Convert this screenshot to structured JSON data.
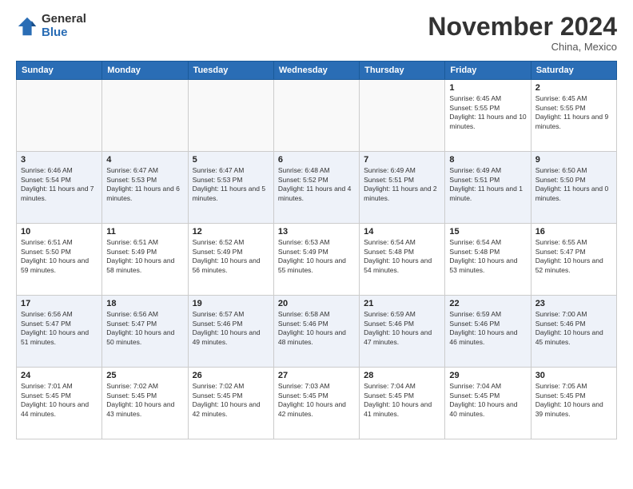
{
  "header": {
    "logo_general": "General",
    "logo_blue": "Blue",
    "month_title": "November 2024",
    "location": "China, Mexico"
  },
  "weekdays": [
    "Sunday",
    "Monday",
    "Tuesday",
    "Wednesday",
    "Thursday",
    "Friday",
    "Saturday"
  ],
  "weeks": [
    [
      {
        "day": "",
        "empty": true
      },
      {
        "day": "",
        "empty": true
      },
      {
        "day": "",
        "empty": true
      },
      {
        "day": "",
        "empty": true
      },
      {
        "day": "",
        "empty": true
      },
      {
        "day": "1",
        "sunrise": "6:45 AM",
        "sunset": "5:55 PM",
        "daylight": "11 hours and 10 minutes."
      },
      {
        "day": "2",
        "sunrise": "6:45 AM",
        "sunset": "5:55 PM",
        "daylight": "11 hours and 9 minutes."
      }
    ],
    [
      {
        "day": "3",
        "sunrise": "6:46 AM",
        "sunset": "5:54 PM",
        "daylight": "11 hours and 7 minutes."
      },
      {
        "day": "4",
        "sunrise": "6:47 AM",
        "sunset": "5:53 PM",
        "daylight": "11 hours and 6 minutes."
      },
      {
        "day": "5",
        "sunrise": "6:47 AM",
        "sunset": "5:53 PM",
        "daylight": "11 hours and 5 minutes."
      },
      {
        "day": "6",
        "sunrise": "6:48 AM",
        "sunset": "5:52 PM",
        "daylight": "11 hours and 4 minutes."
      },
      {
        "day": "7",
        "sunrise": "6:49 AM",
        "sunset": "5:51 PM",
        "daylight": "11 hours and 2 minutes."
      },
      {
        "day": "8",
        "sunrise": "6:49 AM",
        "sunset": "5:51 PM",
        "daylight": "11 hours and 1 minute."
      },
      {
        "day": "9",
        "sunrise": "6:50 AM",
        "sunset": "5:50 PM",
        "daylight": "11 hours and 0 minutes."
      }
    ],
    [
      {
        "day": "10",
        "sunrise": "6:51 AM",
        "sunset": "5:50 PM",
        "daylight": "10 hours and 59 minutes."
      },
      {
        "day": "11",
        "sunrise": "6:51 AM",
        "sunset": "5:49 PM",
        "daylight": "10 hours and 58 minutes."
      },
      {
        "day": "12",
        "sunrise": "6:52 AM",
        "sunset": "5:49 PM",
        "daylight": "10 hours and 56 minutes."
      },
      {
        "day": "13",
        "sunrise": "6:53 AM",
        "sunset": "5:49 PM",
        "daylight": "10 hours and 55 minutes."
      },
      {
        "day": "14",
        "sunrise": "6:54 AM",
        "sunset": "5:48 PM",
        "daylight": "10 hours and 54 minutes."
      },
      {
        "day": "15",
        "sunrise": "6:54 AM",
        "sunset": "5:48 PM",
        "daylight": "10 hours and 53 minutes."
      },
      {
        "day": "16",
        "sunrise": "6:55 AM",
        "sunset": "5:47 PM",
        "daylight": "10 hours and 52 minutes."
      }
    ],
    [
      {
        "day": "17",
        "sunrise": "6:56 AM",
        "sunset": "5:47 PM",
        "daylight": "10 hours and 51 minutes."
      },
      {
        "day": "18",
        "sunrise": "6:56 AM",
        "sunset": "5:47 PM",
        "daylight": "10 hours and 50 minutes."
      },
      {
        "day": "19",
        "sunrise": "6:57 AM",
        "sunset": "5:46 PM",
        "daylight": "10 hours and 49 minutes."
      },
      {
        "day": "20",
        "sunrise": "6:58 AM",
        "sunset": "5:46 PM",
        "daylight": "10 hours and 48 minutes."
      },
      {
        "day": "21",
        "sunrise": "6:59 AM",
        "sunset": "5:46 PM",
        "daylight": "10 hours and 47 minutes."
      },
      {
        "day": "22",
        "sunrise": "6:59 AM",
        "sunset": "5:46 PM",
        "daylight": "10 hours and 46 minutes."
      },
      {
        "day": "23",
        "sunrise": "7:00 AM",
        "sunset": "5:46 PM",
        "daylight": "10 hours and 45 minutes."
      }
    ],
    [
      {
        "day": "24",
        "sunrise": "7:01 AM",
        "sunset": "5:45 PM",
        "daylight": "10 hours and 44 minutes."
      },
      {
        "day": "25",
        "sunrise": "7:02 AM",
        "sunset": "5:45 PM",
        "daylight": "10 hours and 43 minutes."
      },
      {
        "day": "26",
        "sunrise": "7:02 AM",
        "sunset": "5:45 PM",
        "daylight": "10 hours and 42 minutes."
      },
      {
        "day": "27",
        "sunrise": "7:03 AM",
        "sunset": "5:45 PM",
        "daylight": "10 hours and 42 minutes."
      },
      {
        "day": "28",
        "sunrise": "7:04 AM",
        "sunset": "5:45 PM",
        "daylight": "10 hours and 41 minutes."
      },
      {
        "day": "29",
        "sunrise": "7:04 AM",
        "sunset": "5:45 PM",
        "daylight": "10 hours and 40 minutes."
      },
      {
        "day": "30",
        "sunrise": "7:05 AM",
        "sunset": "5:45 PM",
        "daylight": "10 hours and 39 minutes."
      }
    ]
  ]
}
